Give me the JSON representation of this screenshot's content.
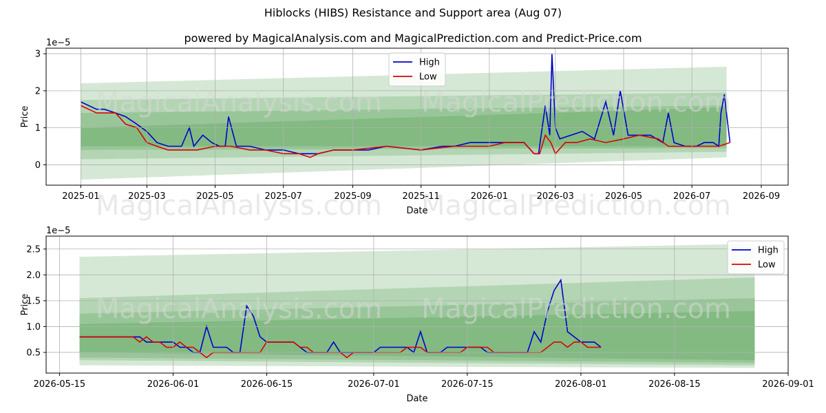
{
  "title": "Hiblocks (HIBS) Resistance and Support area (Aug 07)",
  "subtitle": "powered by MagicalAnalysis.com and MagicalPrediction.com and Predict-Price.com",
  "watermarks": [
    "MagicalAnalysis.com",
    "MagicalPrediction.com"
  ],
  "colors": {
    "high": "#0000cc",
    "low": "#dd0000",
    "band": "#2e8b2e",
    "grid": "#b0b0b0"
  },
  "chart_data": [
    {
      "type": "line",
      "title": "",
      "xlabel": "Date",
      "ylabel": "Price",
      "y_exponent_label": "1e−5",
      "xlim": [
        "2024-12-01",
        "2026-09-25"
      ],
      "ylim": [
        -0.55,
        3.15
      ],
      "x_ticks": [
        "2025-01",
        "2025-03",
        "2025-05",
        "2025-07",
        "2025-09",
        "2025-11",
        "2026-01",
        "2026-03",
        "2026-05",
        "2026-07",
        "2026-09"
      ],
      "x_tick_dates": [
        "2025-01-01",
        "2025-03-01",
        "2025-05-01",
        "2025-07-01",
        "2025-09-01",
        "2025-11-01",
        "2026-01-01",
        "2026-03-01",
        "2026-05-01",
        "2026-07-01",
        "2026-09-01"
      ],
      "y_ticks": [
        "0",
        "1",
        "2",
        "3"
      ],
      "y_tick_values": [
        0,
        1,
        2,
        3
      ],
      "grid": true,
      "legend": "upper center",
      "bands": [
        {
          "x": [
            "2025-01-01",
            "2026-08-01"
          ],
          "lower": [
            -0.4,
            0.2
          ],
          "upper": [
            2.2,
            2.65
          ]
        },
        {
          "x": [
            "2025-01-01",
            "2026-08-01"
          ],
          "lower": [
            0.15,
            0.35
          ],
          "upper": [
            1.75,
            1.95
          ]
        },
        {
          "x": [
            "2025-01-01",
            "2026-08-01"
          ],
          "lower": [
            0.4,
            0.45
          ],
          "upper": [
            1.0,
            1.55
          ]
        },
        {
          "x": [
            "2025-01-01",
            "2026-08-01"
          ],
          "lower": [
            0.5,
            0.5
          ],
          "upper": [
            1.4,
            1.6
          ]
        }
      ],
      "series": [
        {
          "name": "High",
          "color": "#0000cc",
          "x": [
            "2025-01-01",
            "2025-01-08",
            "2025-01-15",
            "2025-01-22",
            "2025-02-01",
            "2025-02-10",
            "2025-02-20",
            "2025-03-01",
            "2025-03-10",
            "2025-03-20",
            "2025-04-01",
            "2025-04-08",
            "2025-04-12",
            "2025-04-20",
            "2025-04-28",
            "2025-05-05",
            "2025-05-10",
            "2025-05-13",
            "2025-05-20",
            "2025-06-01",
            "2025-06-15",
            "2025-07-01",
            "2025-07-15",
            "2025-08-01",
            "2025-08-15",
            "2025-09-01",
            "2025-09-15",
            "2025-10-01",
            "2025-11-01",
            "2025-11-20",
            "2025-12-01",
            "2025-12-15",
            "2026-01-01",
            "2026-01-15",
            "2026-02-01",
            "2026-02-10",
            "2026-02-14",
            "2026-02-20",
            "2026-02-24",
            "2026-02-26",
            "2026-03-01",
            "2026-03-05",
            "2026-03-15",
            "2026-03-25",
            "2026-04-05",
            "2026-04-15",
            "2026-04-22",
            "2026-04-28",
            "2026-05-05",
            "2026-05-15",
            "2026-05-25",
            "2026-06-05",
            "2026-06-10",
            "2026-06-15",
            "2026-06-25",
            "2026-07-05",
            "2026-07-12",
            "2026-07-20",
            "2026-07-25",
            "2026-07-27",
            "2026-07-30",
            "2026-08-04"
          ],
          "values": [
            1.7,
            1.6,
            1.5,
            1.5,
            1.4,
            1.3,
            1.1,
            0.9,
            0.6,
            0.5,
            0.5,
            1.0,
            0.5,
            0.8,
            0.6,
            0.5,
            0.5,
            1.3,
            0.5,
            0.5,
            0.4,
            0.4,
            0.3,
            0.3,
            0.4,
            0.4,
            0.4,
            0.5,
            0.4,
            0.5,
            0.5,
            0.6,
            0.6,
            0.6,
            0.6,
            0.3,
            0.3,
            1.6,
            0.8,
            3.0,
            1.0,
            0.7,
            0.8,
            0.9,
            0.7,
            1.7,
            0.8,
            2.0,
            0.8,
            0.8,
            0.8,
            0.6,
            1.4,
            0.6,
            0.5,
            0.5,
            0.6,
            0.6,
            0.5,
            1.4,
            1.9,
            0.6
          ]
        },
        {
          "name": "Low",
          "color": "#dd0000",
          "x": [
            "2025-01-01",
            "2025-01-08",
            "2025-01-15",
            "2025-01-22",
            "2025-02-01",
            "2025-02-10",
            "2025-02-20",
            "2025-03-01",
            "2025-03-10",
            "2025-03-20",
            "2025-04-01",
            "2025-04-15",
            "2025-05-01",
            "2025-05-15",
            "2025-06-01",
            "2025-06-15",
            "2025-07-01",
            "2025-07-15",
            "2025-07-25",
            "2025-08-01",
            "2025-08-15",
            "2025-09-01",
            "2025-10-01",
            "2025-11-01",
            "2025-12-01",
            "2025-12-15",
            "2026-01-01",
            "2026-01-15",
            "2026-02-01",
            "2026-02-10",
            "2026-02-15",
            "2026-02-20",
            "2026-02-25",
            "2026-03-01",
            "2026-03-10",
            "2026-03-20",
            "2026-04-01",
            "2026-04-15",
            "2026-05-01",
            "2026-05-15",
            "2026-06-01",
            "2026-06-10",
            "2026-06-20",
            "2026-07-01",
            "2026-07-15",
            "2026-07-25",
            "2026-08-04"
          ],
          "values": [
            1.6,
            1.5,
            1.4,
            1.4,
            1.4,
            1.1,
            1.0,
            0.6,
            0.5,
            0.4,
            0.4,
            0.4,
            0.5,
            0.5,
            0.4,
            0.4,
            0.3,
            0.3,
            0.2,
            0.3,
            0.4,
            0.4,
            0.5,
            0.4,
            0.5,
            0.5,
            0.5,
            0.6,
            0.6,
            0.3,
            0.3,
            0.8,
            0.6,
            0.3,
            0.6,
            0.6,
            0.7,
            0.6,
            0.7,
            0.8,
            0.7,
            0.5,
            0.5,
            0.5,
            0.5,
            0.5,
            0.6
          ]
        }
      ]
    },
    {
      "type": "line",
      "title": "",
      "xlabel": "Date",
      "ylabel": "Price",
      "y_exponent_label": "1e−5",
      "xlim": [
        "2026-05-13",
        "2026-09-01"
      ],
      "ylim": [
        0.1,
        2.75
      ],
      "x_ticks": [
        "2026-05-15",
        "2026-06-01",
        "2026-06-15",
        "2026-07-01",
        "2026-07-15",
        "2026-08-01",
        "2026-08-15",
        "2026-09-01"
      ],
      "x_tick_dates": [
        "2026-05-15",
        "2026-06-01",
        "2026-06-15",
        "2026-07-01",
        "2026-07-15",
        "2026-08-01",
        "2026-08-15",
        "2026-09-01"
      ],
      "y_ticks": [
        "0.5",
        "1.0",
        "1.5",
        "2.0",
        "2.5"
      ],
      "y_tick_values": [
        0.5,
        1.0,
        1.5,
        2.0,
        2.5
      ],
      "grid": true,
      "legend": "upper right",
      "bands": [
        {
          "x": [
            "2026-05-18",
            "2026-08-27"
          ],
          "lower": [
            0.25,
            0.2
          ],
          "upper": [
            2.35,
            2.6
          ]
        },
        {
          "x": [
            "2026-05-18",
            "2026-08-27"
          ],
          "lower": [
            0.35,
            0.25
          ],
          "upper": [
            1.55,
            1.95
          ]
        },
        {
          "x": [
            "2026-05-18",
            "2026-08-27"
          ],
          "lower": [
            0.4,
            0.3
          ],
          "upper": [
            1.25,
            1.55
          ]
        },
        {
          "x": [
            "2026-05-18",
            "2026-08-27"
          ],
          "lower": [
            0.5,
            0.35
          ],
          "upper": [
            1.05,
            1.3
          ]
        }
      ],
      "series": [
        {
          "name": "High",
          "color": "#0000cc",
          "x": [
            "2026-05-18",
            "2026-05-19",
            "2026-05-20",
            "2026-05-21",
            "2026-05-22",
            "2026-05-23",
            "2026-05-24",
            "2026-05-25",
            "2026-05-26",
            "2026-05-27",
            "2026-05-28",
            "2026-05-29",
            "2026-05-30",
            "2026-05-31",
            "2026-06-01",
            "2026-06-02",
            "2026-06-03",
            "2026-06-04",
            "2026-06-05",
            "2026-06-06",
            "2026-06-07",
            "2026-06-08",
            "2026-06-09",
            "2026-06-10",
            "2026-06-11",
            "2026-06-12",
            "2026-06-13",
            "2026-06-14",
            "2026-06-15",
            "2026-06-16",
            "2026-06-17",
            "2026-06-18",
            "2026-06-19",
            "2026-06-20",
            "2026-06-21",
            "2026-06-22",
            "2026-06-23",
            "2026-06-24",
            "2026-06-25",
            "2026-06-26",
            "2026-06-27",
            "2026-06-28",
            "2026-06-29",
            "2026-06-30",
            "2026-07-01",
            "2026-07-02",
            "2026-07-03",
            "2026-07-04",
            "2026-07-05",
            "2026-07-06",
            "2026-07-07",
            "2026-07-08",
            "2026-07-09",
            "2026-07-10",
            "2026-07-11",
            "2026-07-12",
            "2026-07-13",
            "2026-07-14",
            "2026-07-15",
            "2026-07-16",
            "2026-07-17",
            "2026-07-18",
            "2026-07-19",
            "2026-07-20",
            "2026-07-21",
            "2026-07-22",
            "2026-07-23",
            "2026-07-24",
            "2026-07-25",
            "2026-07-26",
            "2026-07-27",
            "2026-07-28",
            "2026-07-29",
            "2026-07-30",
            "2026-07-31",
            "2026-08-01",
            "2026-08-02",
            "2026-08-03",
            "2026-08-04"
          ],
          "values": [
            0.8,
            0.8,
            0.8,
            0.8,
            0.8,
            0.8,
            0.8,
            0.8,
            0.8,
            0.8,
            0.7,
            0.7,
            0.7,
            0.7,
            0.7,
            0.6,
            0.6,
            0.5,
            0.5,
            1.0,
            0.6,
            0.6,
            0.6,
            0.5,
            0.5,
            1.4,
            1.2,
            0.8,
            0.7,
            0.7,
            0.7,
            0.7,
            0.7,
            0.6,
            0.5,
            0.5,
            0.5,
            0.5,
            0.7,
            0.5,
            0.5,
            0.5,
            0.5,
            0.5,
            0.5,
            0.6,
            0.6,
            0.6,
            0.6,
            0.6,
            0.5,
            0.9,
            0.5,
            0.5,
            0.5,
            0.6,
            0.6,
            0.6,
            0.6,
            0.6,
            0.6,
            0.5,
            0.5,
            0.5,
            0.5,
            0.5,
            0.5,
            0.5,
            0.9,
            0.7,
            1.3,
            1.7,
            1.9,
            0.9,
            0.8,
            0.7,
            0.7,
            0.7,
            0.6
          ]
        },
        {
          "name": "Low",
          "color": "#dd0000",
          "x": [
            "2026-05-18",
            "2026-05-19",
            "2026-05-20",
            "2026-05-21",
            "2026-05-22",
            "2026-05-23",
            "2026-05-24",
            "2026-05-25",
            "2026-05-26",
            "2026-05-27",
            "2026-05-28",
            "2026-05-29",
            "2026-05-30",
            "2026-05-31",
            "2026-06-01",
            "2026-06-02",
            "2026-06-03",
            "2026-06-04",
            "2026-06-05",
            "2026-06-06",
            "2026-06-07",
            "2026-06-08",
            "2026-06-09",
            "2026-06-10",
            "2026-06-11",
            "2026-06-12",
            "2026-06-13",
            "2026-06-14",
            "2026-06-15",
            "2026-06-16",
            "2026-06-17",
            "2026-06-18",
            "2026-06-19",
            "2026-06-20",
            "2026-06-21",
            "2026-06-22",
            "2026-06-23",
            "2026-06-24",
            "2026-06-25",
            "2026-06-26",
            "2026-06-27",
            "2026-06-28",
            "2026-06-29",
            "2026-06-30",
            "2026-07-01",
            "2026-07-02",
            "2026-07-03",
            "2026-07-04",
            "2026-07-05",
            "2026-07-06",
            "2026-07-07",
            "2026-07-08",
            "2026-07-09",
            "2026-07-10",
            "2026-07-11",
            "2026-07-12",
            "2026-07-13",
            "2026-07-14",
            "2026-07-15",
            "2026-07-16",
            "2026-07-17",
            "2026-07-18",
            "2026-07-19",
            "2026-07-20",
            "2026-07-21",
            "2026-07-22",
            "2026-07-23",
            "2026-07-24",
            "2026-07-25",
            "2026-07-26",
            "2026-07-27",
            "2026-07-28",
            "2026-07-29",
            "2026-07-30",
            "2026-07-31",
            "2026-08-01",
            "2026-08-02",
            "2026-08-03",
            "2026-08-04"
          ],
          "values": [
            0.8,
            0.8,
            0.8,
            0.8,
            0.8,
            0.8,
            0.8,
            0.8,
            0.8,
            0.7,
            0.8,
            0.7,
            0.7,
            0.6,
            0.6,
            0.7,
            0.6,
            0.6,
            0.5,
            0.4,
            0.5,
            0.5,
            0.5,
            0.5,
            0.5,
            0.5,
            0.5,
            0.5,
            0.7,
            0.7,
            0.7,
            0.7,
            0.7,
            0.6,
            0.6,
            0.5,
            0.5,
            0.5,
            0.5,
            0.5,
            0.4,
            0.5,
            0.5,
            0.5,
            0.5,
            0.5,
            0.5,
            0.5,
            0.5,
            0.6,
            0.6,
            0.6,
            0.5,
            0.5,
            0.5,
            0.5,
            0.5,
            0.5,
            0.6,
            0.6,
            0.6,
            0.6,
            0.5,
            0.5,
            0.5,
            0.5,
            0.5,
            0.5,
            0.5,
            0.5,
            0.6,
            0.7,
            0.7,
            0.6,
            0.7,
            0.7,
            0.6,
            0.6,
            0.6
          ]
        }
      ]
    }
  ]
}
